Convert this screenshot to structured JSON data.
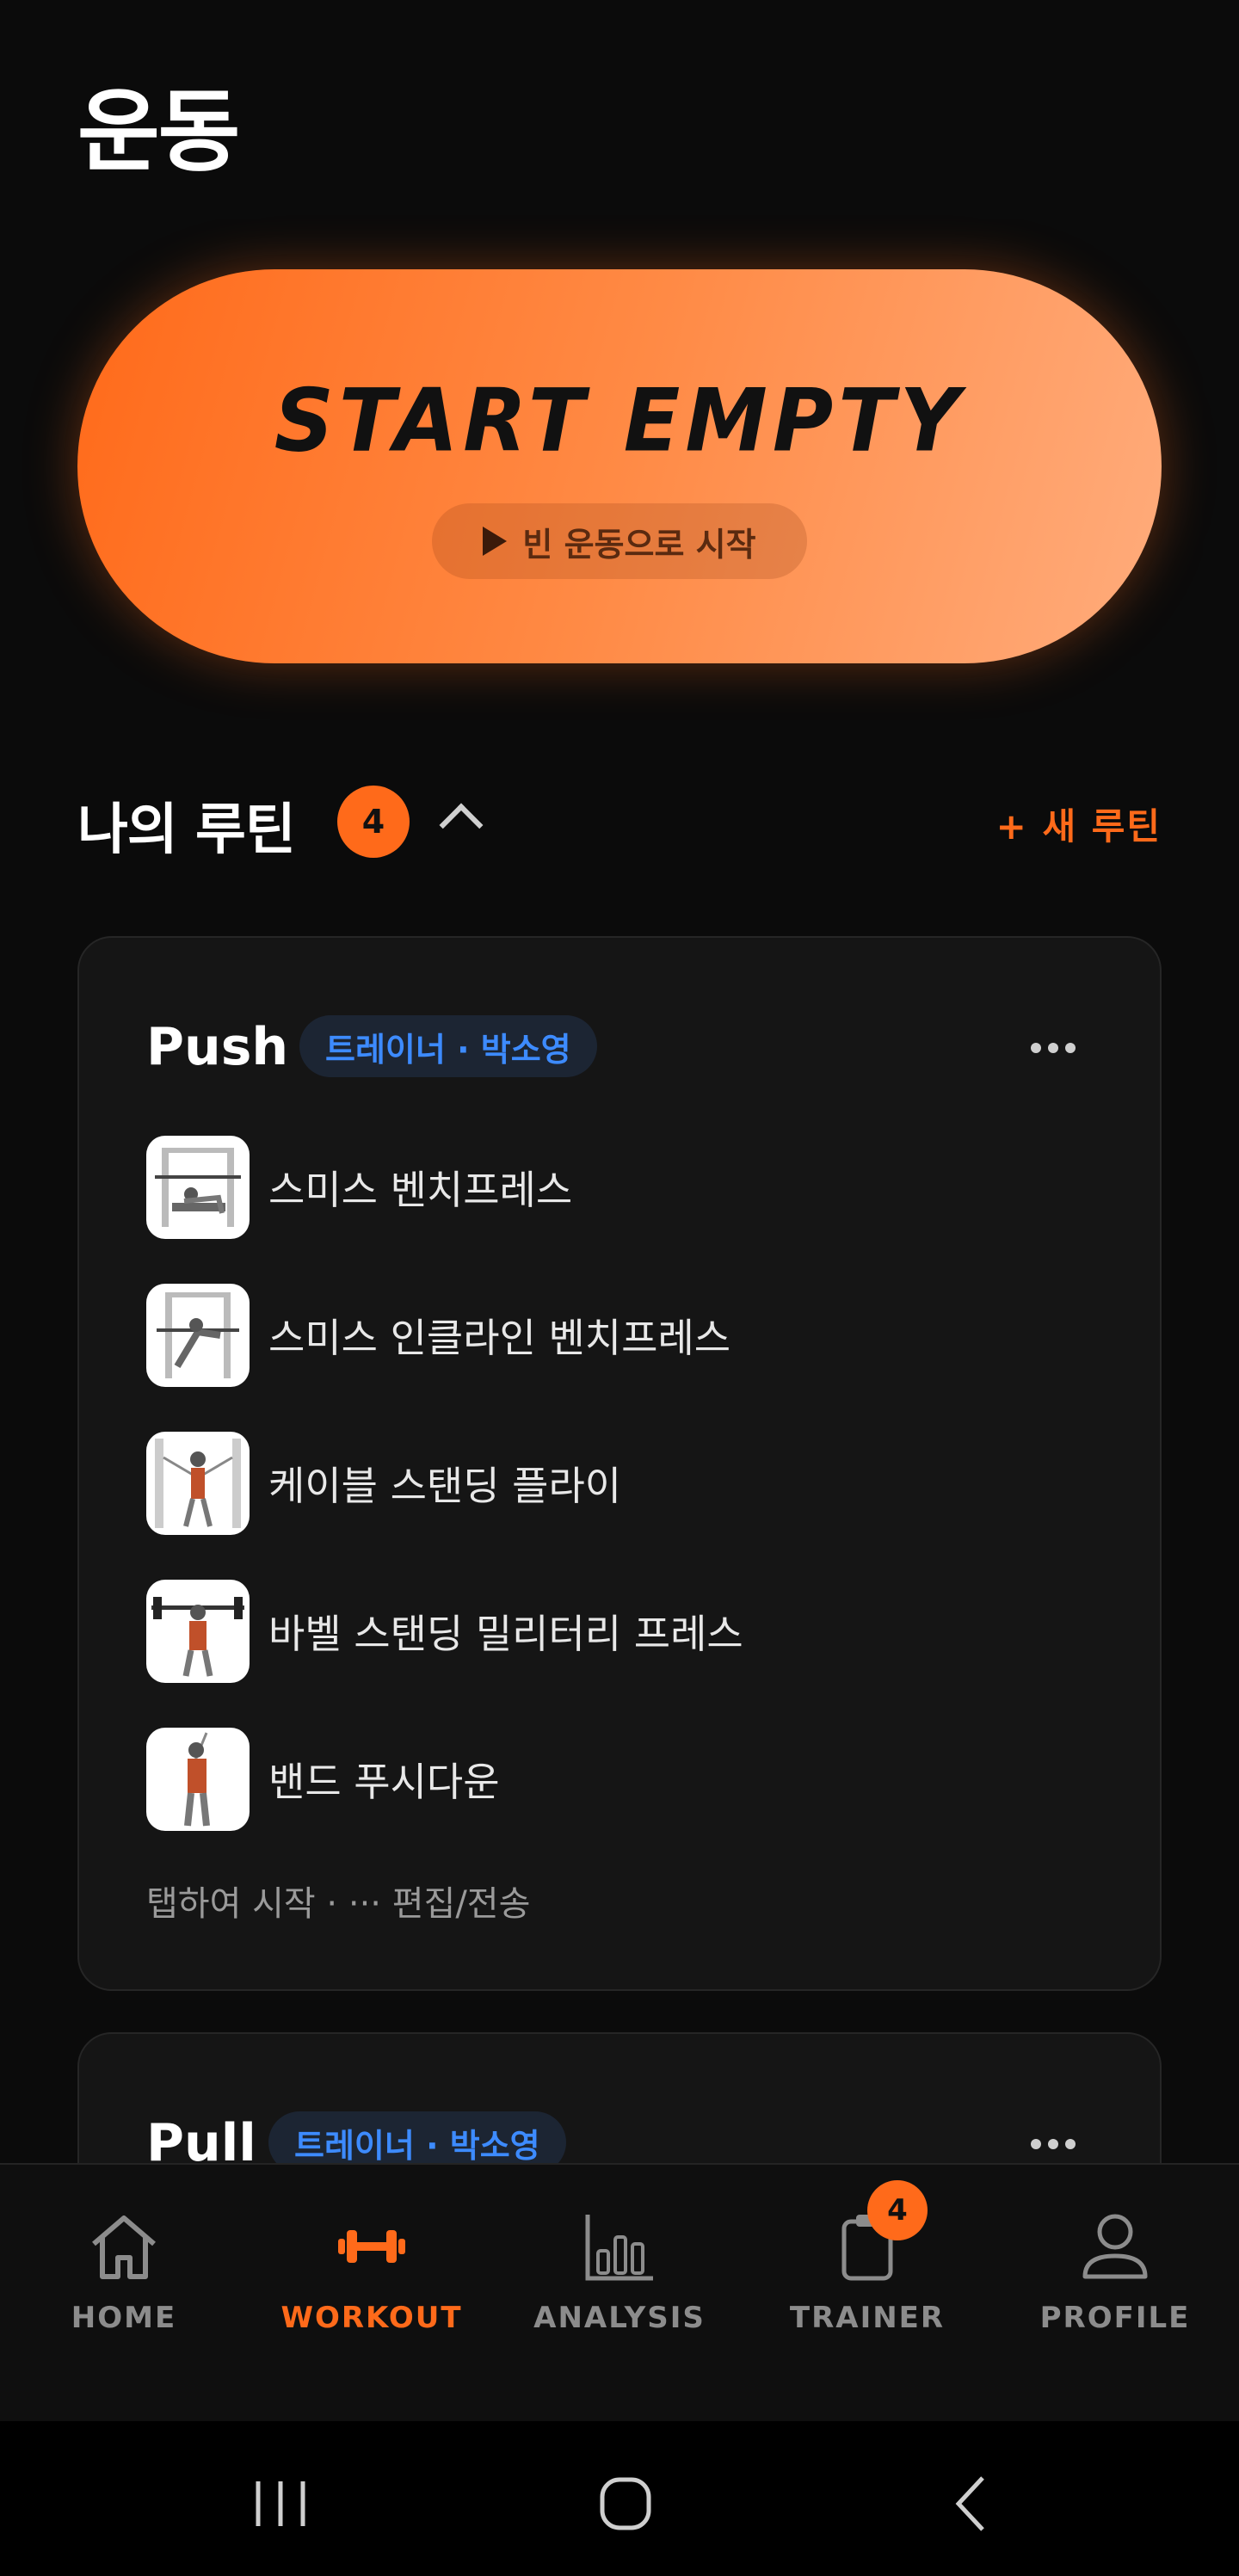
{
  "page": {
    "title": "운동"
  },
  "start": {
    "title": "START EMPTY",
    "subtitle": "빈 운동으로 시작"
  },
  "routines": {
    "title": "나의 루틴",
    "count": "4",
    "new_label": "+ 새 루틴",
    "cards": [
      {
        "title": "Push",
        "trainer": "트레이너 · 박소영",
        "exercises": [
          "스미스 벤치프레스",
          "스미스 인클라인 벤치프레스",
          "케이블 스탠딩 플라이",
          "바벨 스탠딩 밀리터리 프레스",
          "밴드 푸시다운"
        ],
        "hint": "탭하여 시작 · ··· 편집/전송"
      },
      {
        "title": "Pull",
        "trainer": "트레이너 · 박소영"
      }
    ]
  },
  "tabs": [
    {
      "label": "HOME",
      "icon": "home-icon"
    },
    {
      "label": "WORKOUT",
      "icon": "dumbbell-icon",
      "active": true
    },
    {
      "label": "ANALYSIS",
      "icon": "bar-chart-icon"
    },
    {
      "label": "TRAINER",
      "icon": "clipboard-icon",
      "badge": "4"
    },
    {
      "label": "PROFILE",
      "icon": "person-icon"
    }
  ],
  "colors": {
    "accent": "#ff6a1a",
    "background": "#0b0b0b",
    "card": "#151515",
    "trainer_badge": "#3d8bff"
  }
}
